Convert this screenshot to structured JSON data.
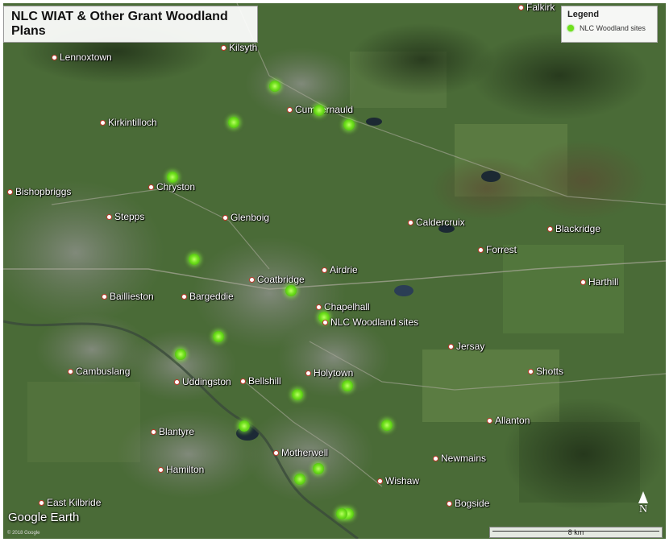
{
  "title": "NLC WIAT & Other Grant Woodland Plans",
  "legend": {
    "heading": "Legend",
    "entry_label": "NLC Woodland sites",
    "entry_color": "#6fe01c"
  },
  "map_label": "NLC Woodland sites",
  "places": [
    {
      "name": "Falkirk"
    },
    {
      "name": "Lennoxtown"
    },
    {
      "name": "Kilsyth"
    },
    {
      "name": "Kirkintilloch"
    },
    {
      "name": "Cumbernauld"
    },
    {
      "name": "Bishopbriggs"
    },
    {
      "name": "Chryston"
    },
    {
      "name": "Stepps"
    },
    {
      "name": "Glenboig"
    },
    {
      "name": "Caldercruix"
    },
    {
      "name": "Blackridge"
    },
    {
      "name": "Forrest"
    },
    {
      "name": "Airdrie"
    },
    {
      "name": "Coatbridge"
    },
    {
      "name": "Harthill"
    },
    {
      "name": "Baillieston"
    },
    {
      "name": "Bargeddie"
    },
    {
      "name": "Chapelhall"
    },
    {
      "name": "Jersay"
    },
    {
      "name": "Cambuslang"
    },
    {
      "name": "Uddingston"
    },
    {
      "name": "Bellshill"
    },
    {
      "name": "Holytown"
    },
    {
      "name": "Shotts"
    },
    {
      "name": "Allanton"
    },
    {
      "name": "Blantyre"
    },
    {
      "name": "Motherwell"
    },
    {
      "name": "Newmains"
    },
    {
      "name": "Hamilton"
    },
    {
      "name": "Wishaw"
    },
    {
      "name": "East Kilbride"
    },
    {
      "name": "Bogside"
    }
  ],
  "branding": "Google Earth",
  "copyright": "© 2018 Google",
  "scale_label": "8 km",
  "north_label": "N"
}
